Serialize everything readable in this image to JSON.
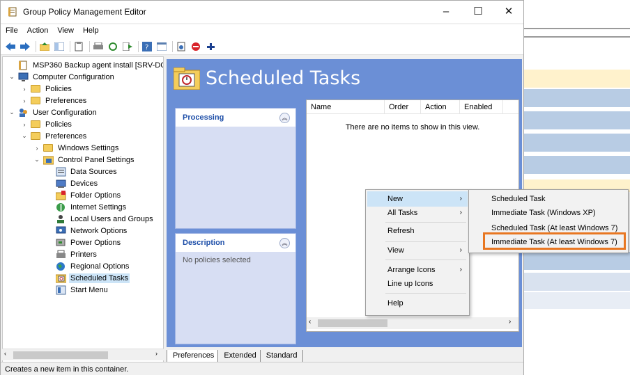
{
  "window": {
    "title": "Group Policy Management Editor"
  },
  "menubar": [
    "File",
    "Action",
    "View",
    "Help"
  ],
  "tree": {
    "items": [
      {
        "label": "MSP360 Backup agent install [SRV-DC.Ol",
        "level": 0,
        "chev": "",
        "icon": "gpo"
      },
      {
        "label": "Computer Configuration",
        "level": 0,
        "chev": "v",
        "icon": "computer"
      },
      {
        "label": "Policies",
        "level": 1,
        "chev": ">",
        "icon": "folder"
      },
      {
        "label": "Preferences",
        "level": 1,
        "chev": ">",
        "icon": "folder"
      },
      {
        "label": "User Configuration",
        "level": 0,
        "chev": "v",
        "icon": "users"
      },
      {
        "label": "Policies",
        "level": 1,
        "chev": ">",
        "icon": "folder"
      },
      {
        "label": "Preferences",
        "level": 1,
        "chev": "v",
        "icon": "folder"
      },
      {
        "label": "Windows Settings",
        "level": 2,
        "chev": ">",
        "icon": "folder"
      },
      {
        "label": "Control Panel Settings",
        "level": 2,
        "chev": "v",
        "icon": "control-panel"
      },
      {
        "label": "Data Sources",
        "level": 3,
        "chev": "",
        "icon": "data-sources"
      },
      {
        "label": "Devices",
        "level": 3,
        "chev": "",
        "icon": "devices"
      },
      {
        "label": "Folder Options",
        "level": 3,
        "chev": "",
        "icon": "folder-options"
      },
      {
        "label": "Internet Settings",
        "level": 3,
        "chev": "",
        "icon": "internet"
      },
      {
        "label": "Local Users and Groups",
        "level": 3,
        "chev": "",
        "icon": "local-users"
      },
      {
        "label": "Network Options",
        "level": 3,
        "chev": "",
        "icon": "network"
      },
      {
        "label": "Power Options",
        "level": 3,
        "chev": "",
        "icon": "power"
      },
      {
        "label": "Printers",
        "level": 3,
        "chev": "",
        "icon": "printer"
      },
      {
        "label": "Regional Options",
        "level": 3,
        "chev": "",
        "icon": "globe"
      },
      {
        "label": "Scheduled Tasks",
        "level": 3,
        "chev": "",
        "icon": "scheduled-task",
        "selected": true
      },
      {
        "label": "Start Menu",
        "level": 3,
        "chev": "",
        "icon": "start-menu"
      }
    ]
  },
  "content": {
    "title": "Scheduled Tasks",
    "processing_title": "Processing",
    "description_title": "Description",
    "description_text": "No policies selected",
    "columns": [
      "Name",
      "Order",
      "Action",
      "Enabled"
    ],
    "empty_text": "There are no items to show in this view."
  },
  "tabs": [
    "Preferences",
    "Extended",
    "Standard"
  ],
  "status": "Creates a new item in this container.",
  "context_menu": {
    "items": [
      {
        "label": "New",
        "arrow": true,
        "highlight": true
      },
      {
        "label": "All Tasks",
        "arrow": true
      },
      {
        "label": "Refresh"
      },
      {
        "label": "View",
        "arrow": true
      },
      {
        "label": "Arrange Icons",
        "arrow": true
      },
      {
        "label": "Line up Icons"
      },
      {
        "label": "Help"
      }
    ]
  },
  "submenu": {
    "items": [
      "Scheduled Task",
      "Immediate Task (Windows XP)",
      "Scheduled Task (At least Windows 7)",
      "Immediate Task (At least Windows 7)"
    ]
  },
  "colors": {
    "content_bg": "#6b8fd6",
    "panel_title": "#1d4ea8",
    "highlight_box": "#e87722",
    "menu_highlight": "#cce4f7"
  }
}
